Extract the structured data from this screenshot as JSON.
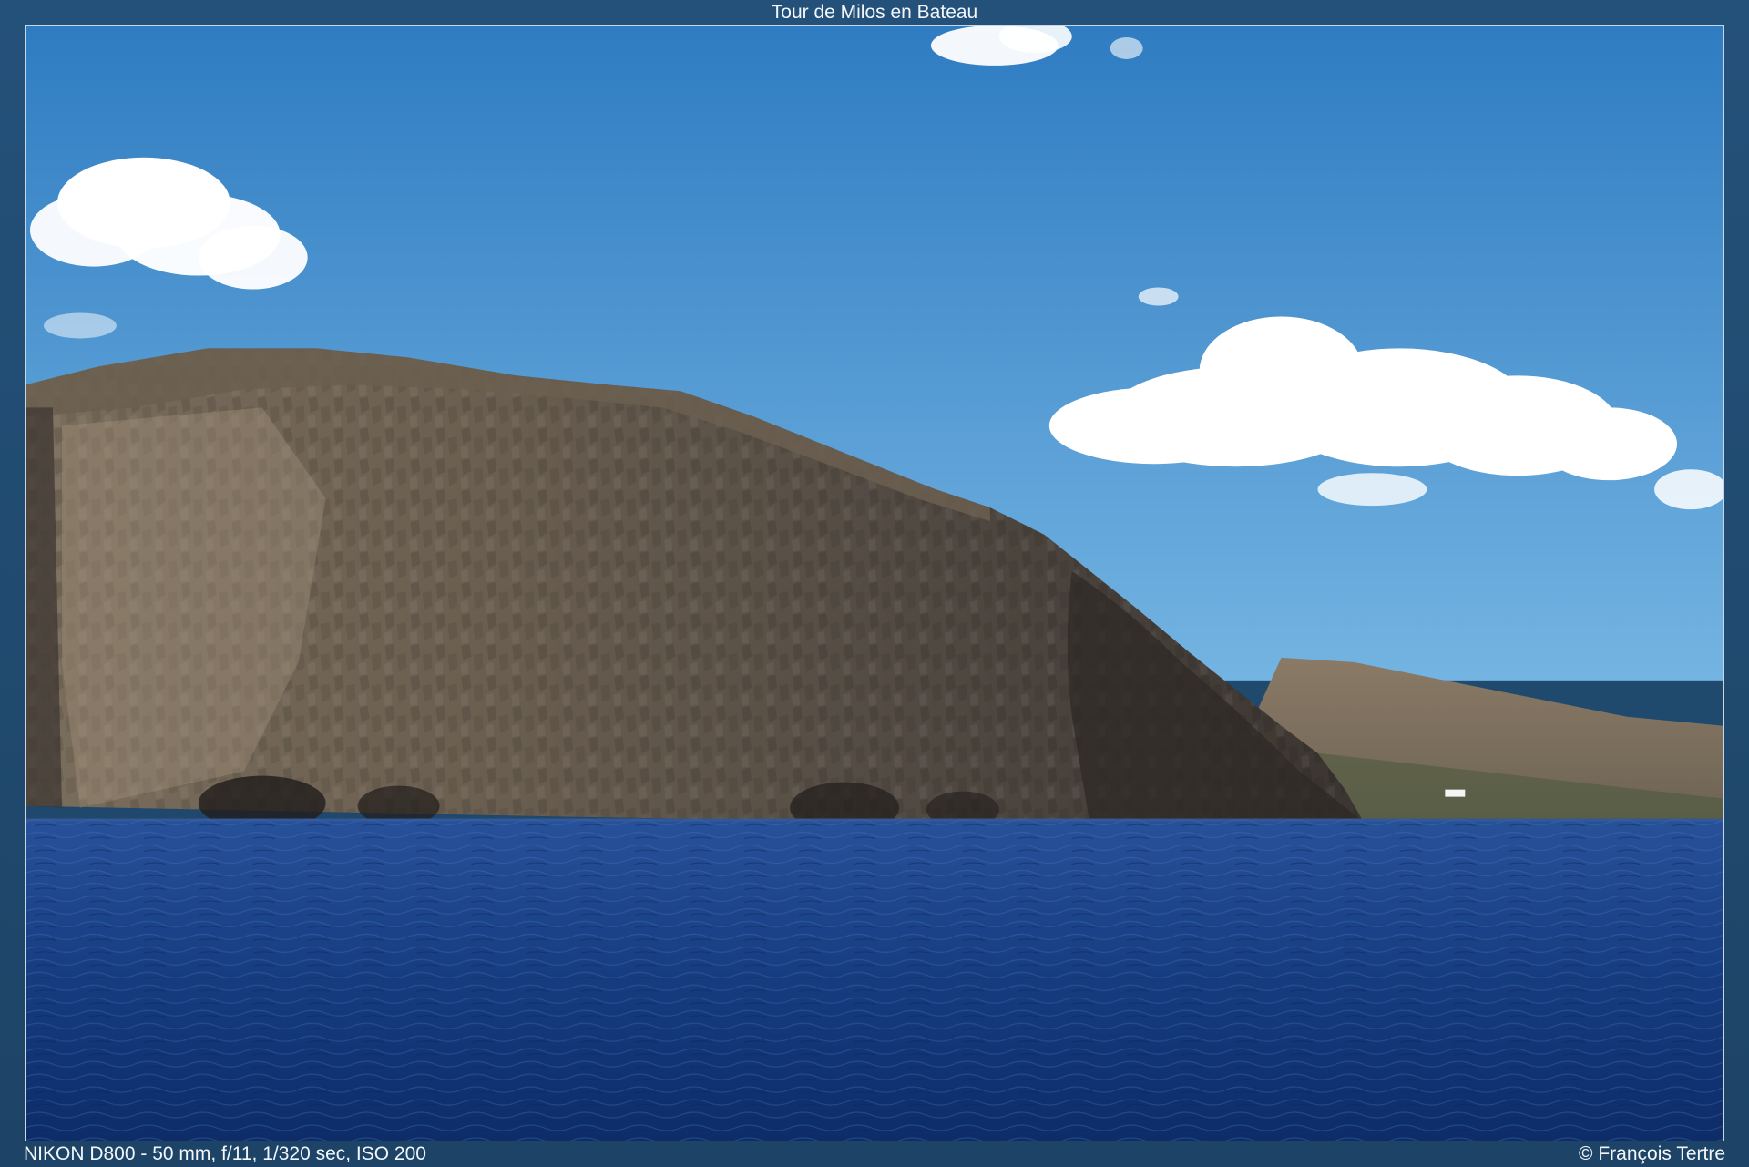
{
  "page": {
    "title": "Tour de Milos en Bateau",
    "exif": "NIKON D800 - 50 mm, f/11, 1/320 sec, ISO 200",
    "credit": "© François Tertre"
  },
  "photo": {
    "colors": {
      "sky_top": "#2f7fc4",
      "sky_bottom": "#6aaede",
      "sea_top": "#234c94",
      "sea_bottom": "#0e2f6e",
      "cliff": "#5f5548",
      "cliff_shadow": "#3a3430",
      "hill": "#7d6e5c",
      "cloud": "#ffffff",
      "frame": "#24517a"
    }
  }
}
